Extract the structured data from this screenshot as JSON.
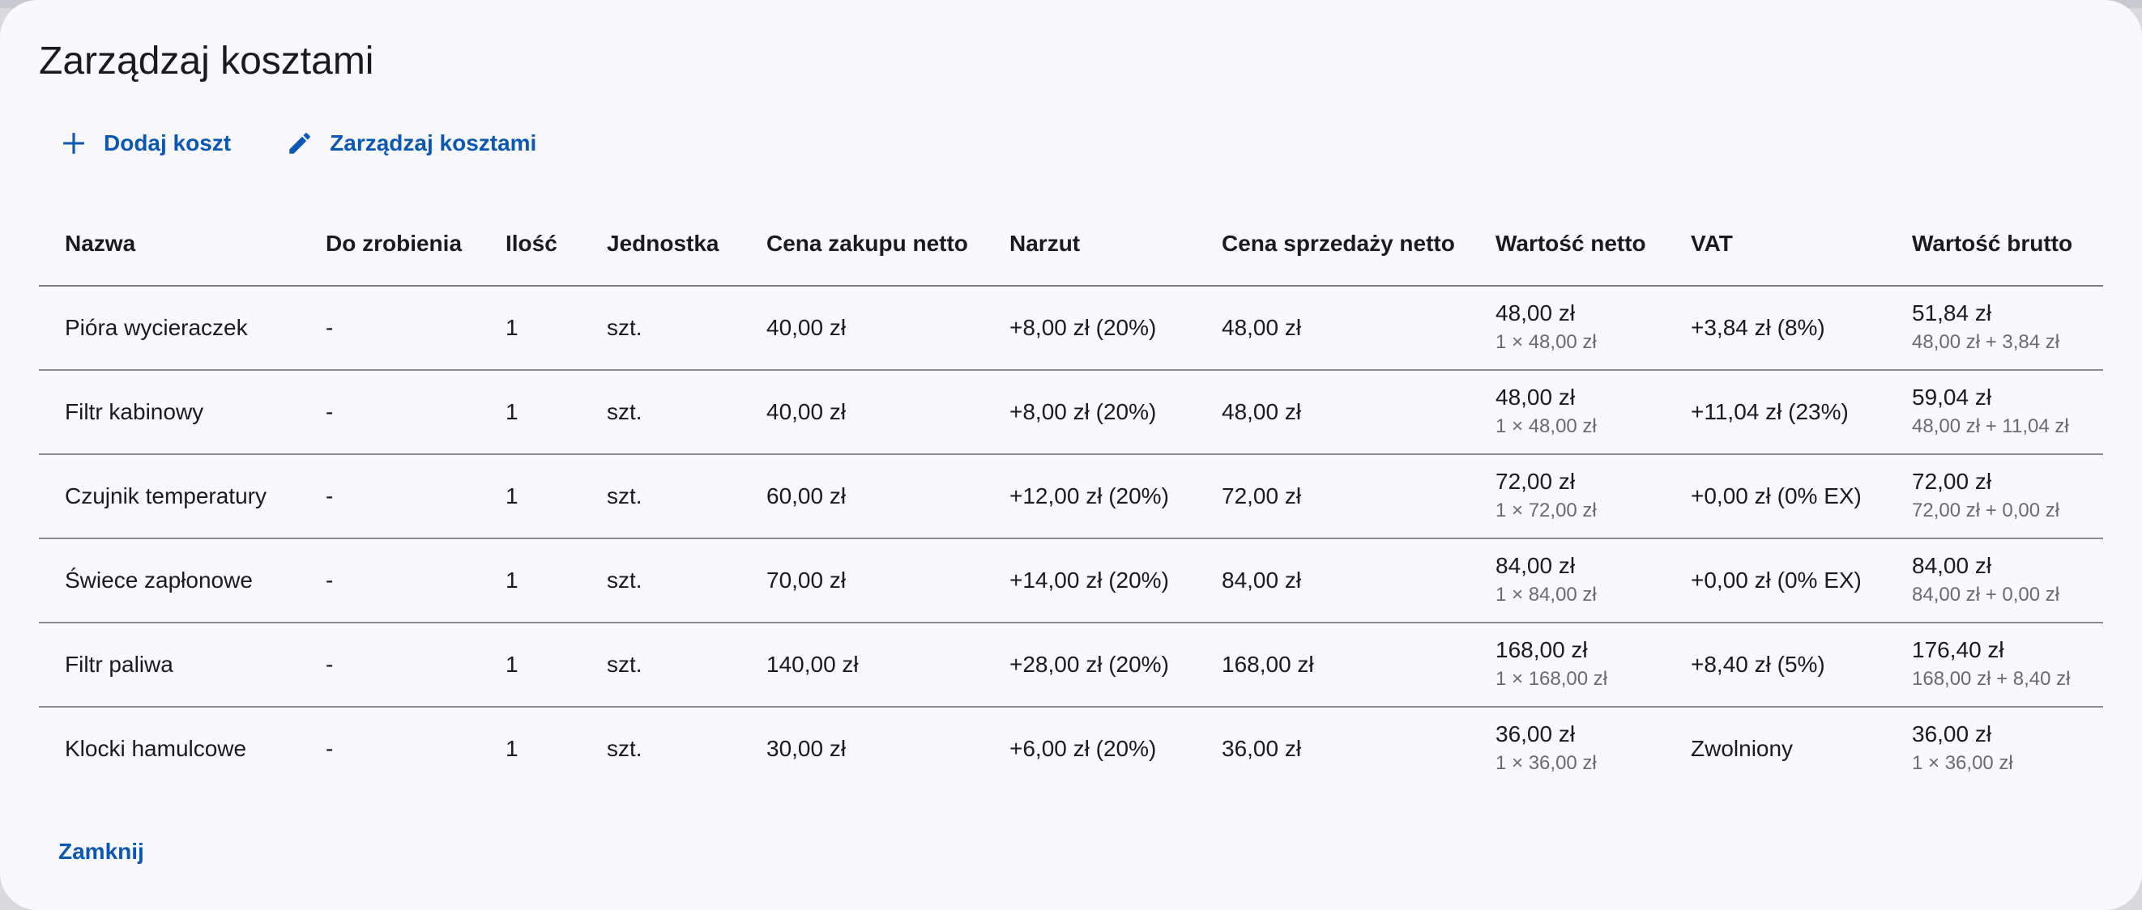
{
  "dialog": {
    "title": "Zarządzaj kosztami",
    "toolbar": {
      "add_label": "Dodaj koszt",
      "manage_label": "Zarządzaj kosztami"
    },
    "close_label": "Zamknij"
  },
  "table": {
    "headers": {
      "name": "Nazwa",
      "todo": "Do zrobienia",
      "qty": "Ilość",
      "unit": "Jednostka",
      "purchase": "Cena zakupu netto",
      "markup": "Narzut",
      "sale": "Cena sprzedaży netto",
      "net_value": "Wartość netto",
      "vat": "VAT",
      "gross_value": "Wartość brutto"
    },
    "rows": [
      {
        "name": "Pióra wycieraczek",
        "todo": "-",
        "qty": "1",
        "unit": "szt.",
        "purchase": "40,00 zł",
        "markup": "+8,00 zł (20%)",
        "sale": "48,00 zł",
        "net_value": "48,00 zł",
        "net_sub": "1 × 48,00 zł",
        "vat": "+3,84 zł (8%)",
        "gross_value": "51,84 zł",
        "gross_sub": "48,00 zł + 3,84 zł"
      },
      {
        "name": "Filtr kabinowy",
        "todo": "-",
        "qty": "1",
        "unit": "szt.",
        "purchase": "40,00 zł",
        "markup": "+8,00 zł (20%)",
        "sale": "48,00 zł",
        "net_value": "48,00 zł",
        "net_sub": "1 × 48,00 zł",
        "vat": "+11,04 zł (23%)",
        "gross_value": "59,04 zł",
        "gross_sub": "48,00 zł + 11,04 zł"
      },
      {
        "name": "Czujnik temperatury",
        "todo": "-",
        "qty": "1",
        "unit": "szt.",
        "purchase": "60,00 zł",
        "markup": "+12,00 zł (20%)",
        "sale": "72,00 zł",
        "net_value": "72,00 zł",
        "net_sub": "1 × 72,00 zł",
        "vat": "+0,00 zł (0% EX)",
        "gross_value": "72,00 zł",
        "gross_sub": "72,00 zł + 0,00 zł"
      },
      {
        "name": "Świece zapłonowe",
        "todo": "-",
        "qty": "1",
        "unit": "szt.",
        "purchase": "70,00 zł",
        "markup": "+14,00 zł (20%)",
        "sale": "84,00 zł",
        "net_value": "84,00 zł",
        "net_sub": "1 × 84,00 zł",
        "vat": "+0,00 zł (0% EX)",
        "gross_value": "84,00 zł",
        "gross_sub": "84,00 zł + 0,00 zł"
      },
      {
        "name": "Filtr paliwa",
        "todo": "-",
        "qty": "1",
        "unit": "szt.",
        "purchase": "140,00 zł",
        "markup": "+28,00 zł (20%)",
        "sale": "168,00 zł",
        "net_value": "168,00 zł",
        "net_sub": "1 × 168,00 zł",
        "vat": "+8,40 zł (5%)",
        "gross_value": "176,40 zł",
        "gross_sub": "168,00 zł + 8,40 zł"
      },
      {
        "name": "Klocki hamulcowe",
        "todo": "-",
        "qty": "1",
        "unit": "szt.",
        "purchase": "30,00 zł",
        "markup": "+6,00 zł (20%)",
        "sale": "36,00 zł",
        "net_value": "36,00 zł",
        "net_sub": "1 × 36,00 zł",
        "vat": "Zwolniony",
        "gross_value": "36,00 zł",
        "gross_sub": "1 × 36,00 zł"
      }
    ]
  },
  "icons": {
    "add": "plus-icon",
    "manage": "pencil-icon"
  },
  "colors": {
    "accent": "#0b57b5",
    "surface": "#f8f8fd",
    "text": "#1b1b1f",
    "muted": "#6a6a72"
  }
}
